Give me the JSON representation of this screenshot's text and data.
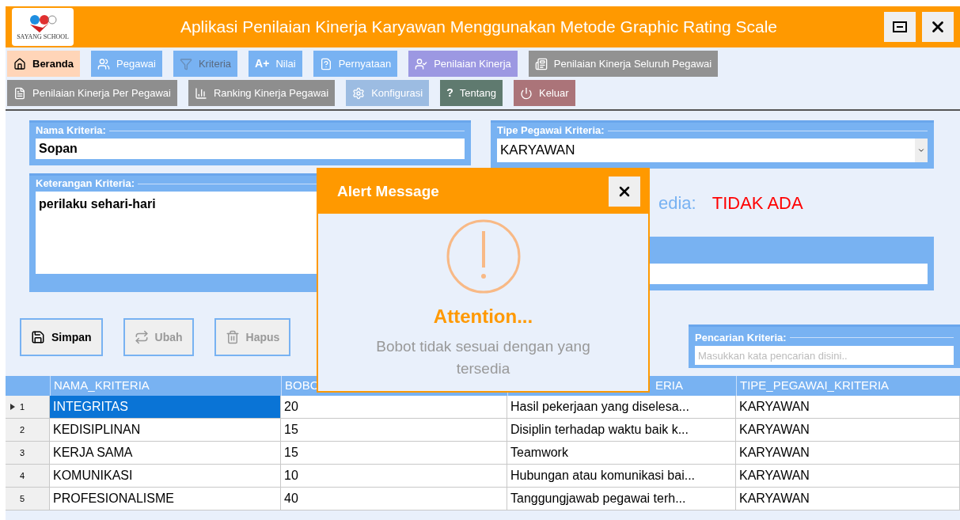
{
  "window": {
    "title": "Aplikasi Penilaian Kinerja Karyawan Menggunakan Metode Graphic Rating Scale",
    "logo_text": "SAYANG SCHOOL"
  },
  "menu_rows": [
    [
      {
        "label": "Beranda",
        "color": "#ffd5b8",
        "selected": true,
        "disabled": false
      },
      {
        "label": "Pegawai",
        "color": "#78b2f2",
        "selected": false,
        "disabled": false
      },
      {
        "label": "Kriteria",
        "color": "#78b2f2",
        "selected": false,
        "disabled": true
      },
      {
        "label": "Nilai",
        "icon_text": "A+",
        "color": "#78b2f2",
        "selected": false,
        "disabled": false
      },
      {
        "label": "Pernyataan",
        "color": "#78b2f2",
        "selected": false,
        "disabled": false
      },
      {
        "label": "Penilaian Kinerja",
        "color": "#9c98e2",
        "selected": false,
        "disabled": false
      },
      {
        "label": "Penilaian Kinerja Seluruh Pegawai",
        "color": "#929292",
        "selected": false,
        "disabled": false
      }
    ],
    [
      {
        "label": "Penilaian Kinerja Per Pegawai",
        "color": "#8e8e8e",
        "selected": false,
        "disabled": false
      },
      {
        "label": "Ranking Kinerja Pegawai",
        "color": "#8e8e8e",
        "selected": false,
        "disabled": false
      },
      {
        "label": "Konfigurasi",
        "color": "#9cbce2",
        "selected": false,
        "disabled": false
      },
      {
        "label": "Tentang",
        "icon_text": "?",
        "color": "#5f7a6f",
        "selected": false,
        "disabled": false
      },
      {
        "label": "Keluar",
        "color": "#ab7479",
        "selected": false,
        "disabled": false
      }
    ]
  ],
  "form": {
    "nama_kriteria": {
      "label": "Nama Kriteria:",
      "value": "Sopan"
    },
    "keterangan_kriteria": {
      "label": "Keterangan Kriteria:",
      "value": "perilaku sehari-hari"
    },
    "tipe_pegawai_kriteria": {
      "label": "Tipe Pegawai Kriteria:",
      "value": "KARYAWAN"
    },
    "status": {
      "label": "edia:",
      "value": "TIDAK ADA"
    },
    "buttons": [
      {
        "label": "Simpan",
        "disabled": false
      },
      {
        "label": "Ubah",
        "disabled": true
      },
      {
        "label": "Hapus",
        "disabled": true
      }
    ],
    "search": {
      "label": "Pencarian Kriteria:",
      "placeholder": "Masukkan kata pencarian disini.."
    }
  },
  "table": {
    "columns": [
      "NAMA_KRITERIA",
      "BOBO",
      "ERIA",
      "TIPE_PEGAWAI_KRITERIA"
    ],
    "rows": [
      {
        "number": "1",
        "selected": true,
        "cells": [
          "INTEGRITAS",
          "20",
          "Hasil pekerjaan yang diselesa...",
          "KARYAWAN"
        ]
      },
      {
        "number": "2",
        "selected": false,
        "cells": [
          "KEDISIPLINAN",
          "15",
          "Disiplin terhadap waktu baik k...",
          "KARYAWAN"
        ]
      },
      {
        "number": "3",
        "selected": false,
        "cells": [
          "KERJA SAMA",
          "15",
          "Teamwork",
          "KARYAWAN"
        ]
      },
      {
        "number": "4",
        "selected": false,
        "cells": [
          "KOMUNIKASI",
          "10",
          "Hubungan atau komunikasi bai...",
          "KARYAWAN"
        ]
      },
      {
        "number": "5",
        "selected": false,
        "cells": [
          "PROFESIONALISME",
          "40",
          "Tanggungjawab pegawai terh...",
          "KARYAWAN"
        ]
      }
    ]
  },
  "dialog": {
    "title": "Alert Message",
    "heading": "Attention...",
    "message": "Bobot tidak sesuai dengan yang tersedia"
  }
}
